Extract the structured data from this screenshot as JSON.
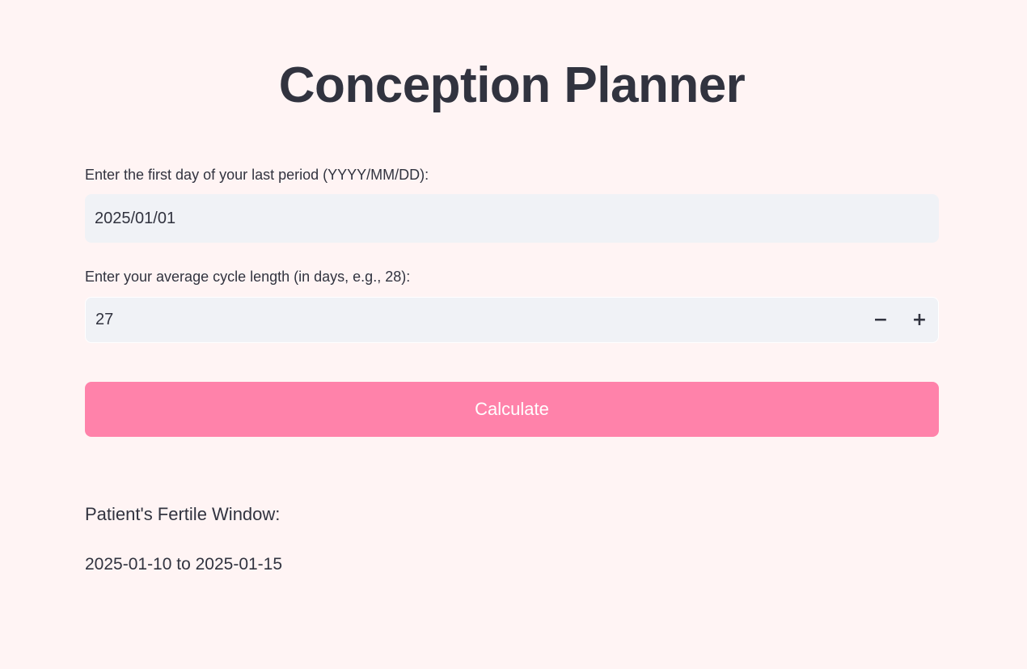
{
  "page": {
    "title": "Conception Planner"
  },
  "form": {
    "date_label": "Enter the first day of your last period (YYYY/MM/DD):",
    "date_value": "2025/01/01",
    "cycle_label": "Enter your average cycle length (in days, e.g., 28):",
    "cycle_value": "27",
    "decrement_symbol": "−",
    "increment_symbol": "+",
    "calculate_label": "Calculate"
  },
  "result": {
    "heading": "Patient's Fertile Window:",
    "value": "2025-01-10 to 2025-01-15"
  },
  "colors": {
    "background": "#fff4f4",
    "input_background": "#f0f2f6",
    "primary_button": "#ff82aa",
    "text": "#31333f"
  }
}
